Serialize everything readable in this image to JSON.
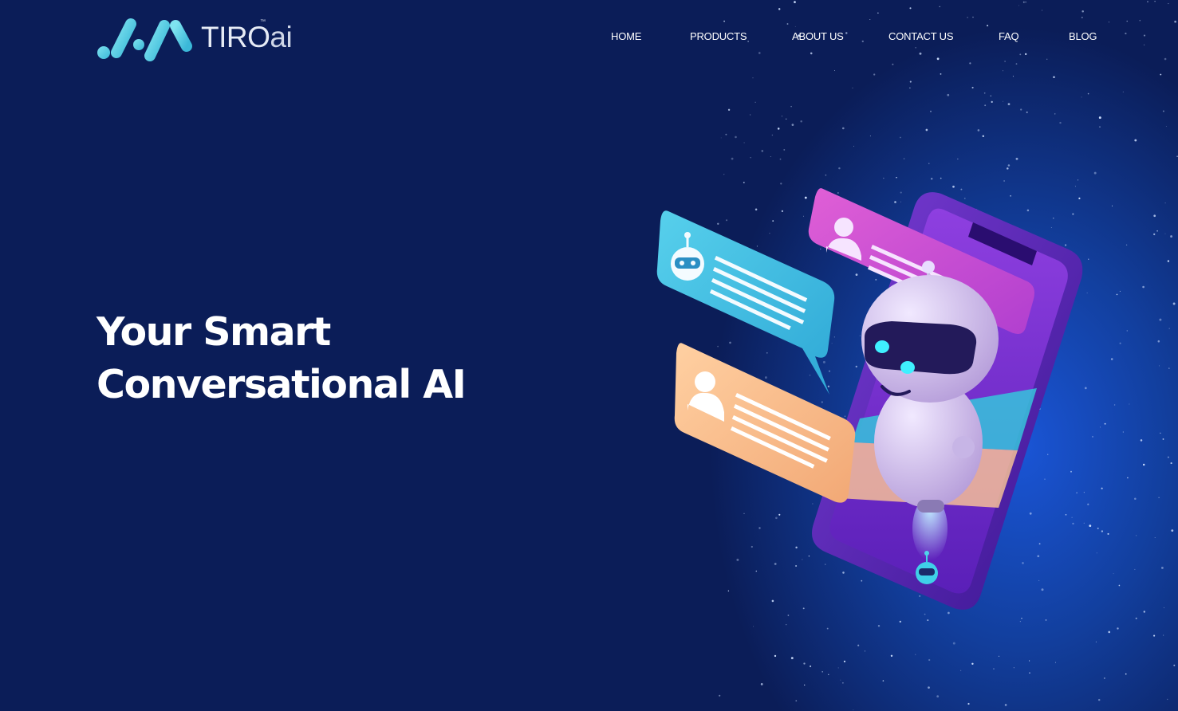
{
  "brand": {
    "name": "TIRO",
    "suffix": "ai",
    "trademark": "™",
    "logo_icon": "tiro-wave-logo-icon",
    "colors": {
      "accent": "#5fd0e6",
      "background": "#0b1d58",
      "glow": "#1a55d6"
    }
  },
  "nav": {
    "items": [
      {
        "label": "HOME"
      },
      {
        "label": "PRODUCTS"
      },
      {
        "label": "ABOUT US"
      },
      {
        "label": "CONTACT US"
      },
      {
        "label": "FAQ"
      },
      {
        "label": "BLOG"
      }
    ]
  },
  "hero": {
    "title_line1": "Your Smart",
    "title_line2": "Conversational AI",
    "illustration_icons": [
      "robot-chat-illustration",
      "smartphone-icon",
      "robot-icon",
      "user-icon",
      "chat-bubble-icon"
    ]
  }
}
